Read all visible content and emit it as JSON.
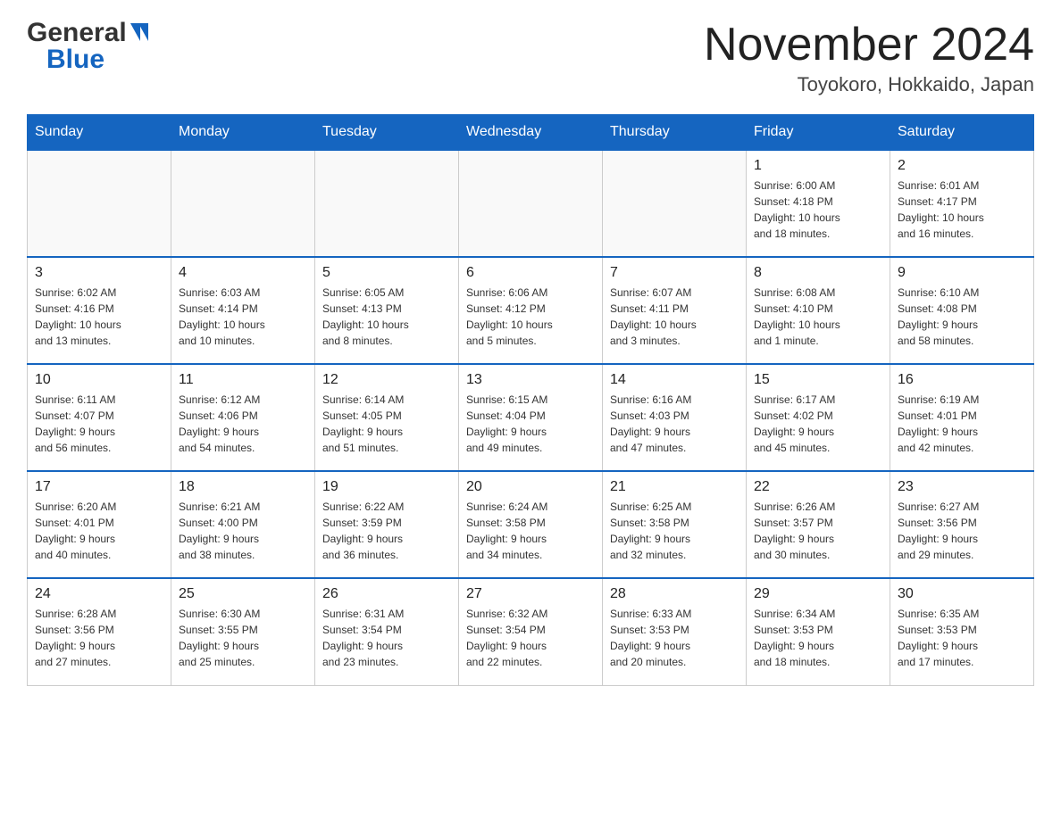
{
  "header": {
    "logo_general": "General",
    "logo_blue": "Blue",
    "month_year": "November 2024",
    "location": "Toyokoro, Hokkaido, Japan"
  },
  "days_of_week": [
    "Sunday",
    "Monday",
    "Tuesday",
    "Wednesday",
    "Thursday",
    "Friday",
    "Saturday"
  ],
  "weeks": [
    [
      {
        "day": "",
        "info": ""
      },
      {
        "day": "",
        "info": ""
      },
      {
        "day": "",
        "info": ""
      },
      {
        "day": "",
        "info": ""
      },
      {
        "day": "",
        "info": ""
      },
      {
        "day": "1",
        "info": "Sunrise: 6:00 AM\nSunset: 4:18 PM\nDaylight: 10 hours\nand 18 minutes."
      },
      {
        "day": "2",
        "info": "Sunrise: 6:01 AM\nSunset: 4:17 PM\nDaylight: 10 hours\nand 16 minutes."
      }
    ],
    [
      {
        "day": "3",
        "info": "Sunrise: 6:02 AM\nSunset: 4:16 PM\nDaylight: 10 hours\nand 13 minutes."
      },
      {
        "day": "4",
        "info": "Sunrise: 6:03 AM\nSunset: 4:14 PM\nDaylight: 10 hours\nand 10 minutes."
      },
      {
        "day": "5",
        "info": "Sunrise: 6:05 AM\nSunset: 4:13 PM\nDaylight: 10 hours\nand 8 minutes."
      },
      {
        "day": "6",
        "info": "Sunrise: 6:06 AM\nSunset: 4:12 PM\nDaylight: 10 hours\nand 5 minutes."
      },
      {
        "day": "7",
        "info": "Sunrise: 6:07 AM\nSunset: 4:11 PM\nDaylight: 10 hours\nand 3 minutes."
      },
      {
        "day": "8",
        "info": "Sunrise: 6:08 AM\nSunset: 4:10 PM\nDaylight: 10 hours\nand 1 minute."
      },
      {
        "day": "9",
        "info": "Sunrise: 6:10 AM\nSunset: 4:08 PM\nDaylight: 9 hours\nand 58 minutes."
      }
    ],
    [
      {
        "day": "10",
        "info": "Sunrise: 6:11 AM\nSunset: 4:07 PM\nDaylight: 9 hours\nand 56 minutes."
      },
      {
        "day": "11",
        "info": "Sunrise: 6:12 AM\nSunset: 4:06 PM\nDaylight: 9 hours\nand 54 minutes."
      },
      {
        "day": "12",
        "info": "Sunrise: 6:14 AM\nSunset: 4:05 PM\nDaylight: 9 hours\nand 51 minutes."
      },
      {
        "day": "13",
        "info": "Sunrise: 6:15 AM\nSunset: 4:04 PM\nDaylight: 9 hours\nand 49 minutes."
      },
      {
        "day": "14",
        "info": "Sunrise: 6:16 AM\nSunset: 4:03 PM\nDaylight: 9 hours\nand 47 minutes."
      },
      {
        "day": "15",
        "info": "Sunrise: 6:17 AM\nSunset: 4:02 PM\nDaylight: 9 hours\nand 45 minutes."
      },
      {
        "day": "16",
        "info": "Sunrise: 6:19 AM\nSunset: 4:01 PM\nDaylight: 9 hours\nand 42 minutes."
      }
    ],
    [
      {
        "day": "17",
        "info": "Sunrise: 6:20 AM\nSunset: 4:01 PM\nDaylight: 9 hours\nand 40 minutes."
      },
      {
        "day": "18",
        "info": "Sunrise: 6:21 AM\nSunset: 4:00 PM\nDaylight: 9 hours\nand 38 minutes."
      },
      {
        "day": "19",
        "info": "Sunrise: 6:22 AM\nSunset: 3:59 PM\nDaylight: 9 hours\nand 36 minutes."
      },
      {
        "day": "20",
        "info": "Sunrise: 6:24 AM\nSunset: 3:58 PM\nDaylight: 9 hours\nand 34 minutes."
      },
      {
        "day": "21",
        "info": "Sunrise: 6:25 AM\nSunset: 3:58 PM\nDaylight: 9 hours\nand 32 minutes."
      },
      {
        "day": "22",
        "info": "Sunrise: 6:26 AM\nSunset: 3:57 PM\nDaylight: 9 hours\nand 30 minutes."
      },
      {
        "day": "23",
        "info": "Sunrise: 6:27 AM\nSunset: 3:56 PM\nDaylight: 9 hours\nand 29 minutes."
      }
    ],
    [
      {
        "day": "24",
        "info": "Sunrise: 6:28 AM\nSunset: 3:56 PM\nDaylight: 9 hours\nand 27 minutes."
      },
      {
        "day": "25",
        "info": "Sunrise: 6:30 AM\nSunset: 3:55 PM\nDaylight: 9 hours\nand 25 minutes."
      },
      {
        "day": "26",
        "info": "Sunrise: 6:31 AM\nSunset: 3:54 PM\nDaylight: 9 hours\nand 23 minutes."
      },
      {
        "day": "27",
        "info": "Sunrise: 6:32 AM\nSunset: 3:54 PM\nDaylight: 9 hours\nand 22 minutes."
      },
      {
        "day": "28",
        "info": "Sunrise: 6:33 AM\nSunset: 3:53 PM\nDaylight: 9 hours\nand 20 minutes."
      },
      {
        "day": "29",
        "info": "Sunrise: 6:34 AM\nSunset: 3:53 PM\nDaylight: 9 hours\nand 18 minutes."
      },
      {
        "day": "30",
        "info": "Sunrise: 6:35 AM\nSunset: 3:53 PM\nDaylight: 9 hours\nand 17 minutes."
      }
    ]
  ]
}
